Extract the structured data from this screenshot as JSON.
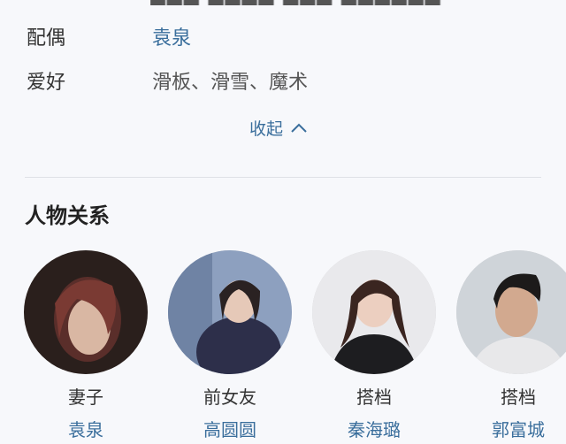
{
  "profile": {
    "spouse_label": "配偶",
    "spouse_value": "袁泉",
    "hobby_label": "爱好",
    "hobby_value": "滑板、滑雪、魔术",
    "collapse_label": "收起"
  },
  "relations": {
    "title": "人物关系",
    "items": [
      {
        "role": "妻子",
        "name": "袁泉"
      },
      {
        "role": "前女友",
        "name": "高圆圆"
      },
      {
        "role": "搭档",
        "name": "秦海璐"
      },
      {
        "role": "搭档",
        "name": "郭富城"
      }
    ]
  },
  "colors": {
    "link": "#3a6e9c",
    "background": "#f7f8fb"
  }
}
